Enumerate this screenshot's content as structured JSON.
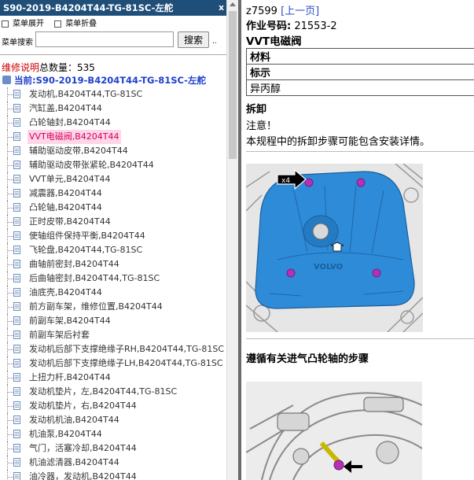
{
  "left": {
    "title": "S90-2019-B4204T44-TG-81SC-左舵",
    "close": "x",
    "menu_expand": "菜单展开",
    "menu_collapse": "菜单折叠",
    "search_label": "菜单搜索",
    "search_value": "",
    "search_button": "搜索",
    "search_extra": "..",
    "total_red": "维修说明",
    "total_label": "总数量：",
    "total_count": "535",
    "current": "当前:S90-2019-B4204T44-TG-81SC-左舵",
    "active_index": 3,
    "items": [
      "发动机,B4204T44,TG-81SC",
      "汽缸盖,B4204T44",
      "凸轮轴封,B4204T44",
      "VVT电磁阀,B4204T44",
      "辅助驱动皮带,B4204T44",
      "辅助驱动皮带张紧轮,B4204T44",
      "VVT单元,B4204T44",
      "减震器,B4204T44",
      "凸轮轴,B4204T44",
      "正时皮带,B4204T44",
      "使轴组件保持平衡,B4204T44",
      "飞轮盘,B4204T44,TG-81SC",
      "曲轴前密封,B4204T44",
      "后曲轴密封,B4204T44,TG-81SC",
      "油底壳,B4204T44",
      "前方副车架，维修位置,B4204T44",
      "前副车架,B4204T44",
      "前副车架后衬套",
      "发动机后部下支撑绝缘子RH,B4204T44,TG-81SC",
      "发动机后部下支撑绝缘子LH,B4204T44,TG-81SC",
      "上扭力杆,B4204T44",
      "发动机垫片，左,B4204T44,TG-81SC",
      "发动机垫片，右,B4204T44",
      "发动机机油,B4204T44",
      "机油泵,B4204T44",
      "气门，活塞冷却,B4204T44",
      "机油滤清器,B4204T44",
      "油冷器，发动机,B4204T44"
    ]
  },
  "right": {
    "doc_id": "z7599",
    "prev_link": "[上一页]",
    "job_label": "作业号码:",
    "job_number": "21553-2",
    "heading": "VVT电磁阀",
    "table": [
      {
        "text": "材料",
        "header": true
      },
      {
        "text": "标示",
        "header": true
      },
      {
        "text": "异丙醇",
        "header": false
      }
    ],
    "remove_heading": "拆卸",
    "note_title": "注意！",
    "note_text": "本规程中的拆卸步骤可能包含安装详情。",
    "image1_callout": "x4",
    "image1_brand": "VOLVO",
    "step2": "遵循有关进气凸轮轴的步骤"
  },
  "colors": {
    "title_bar": "#1f4e79",
    "link": "#2a4ec9",
    "active_item": "#d4005a",
    "active_bg": "#ffd6e8",
    "current_path": "#1f3fcc",
    "cover_blue": "#2e8bd8",
    "bolt_magenta": "#b62fb8"
  }
}
